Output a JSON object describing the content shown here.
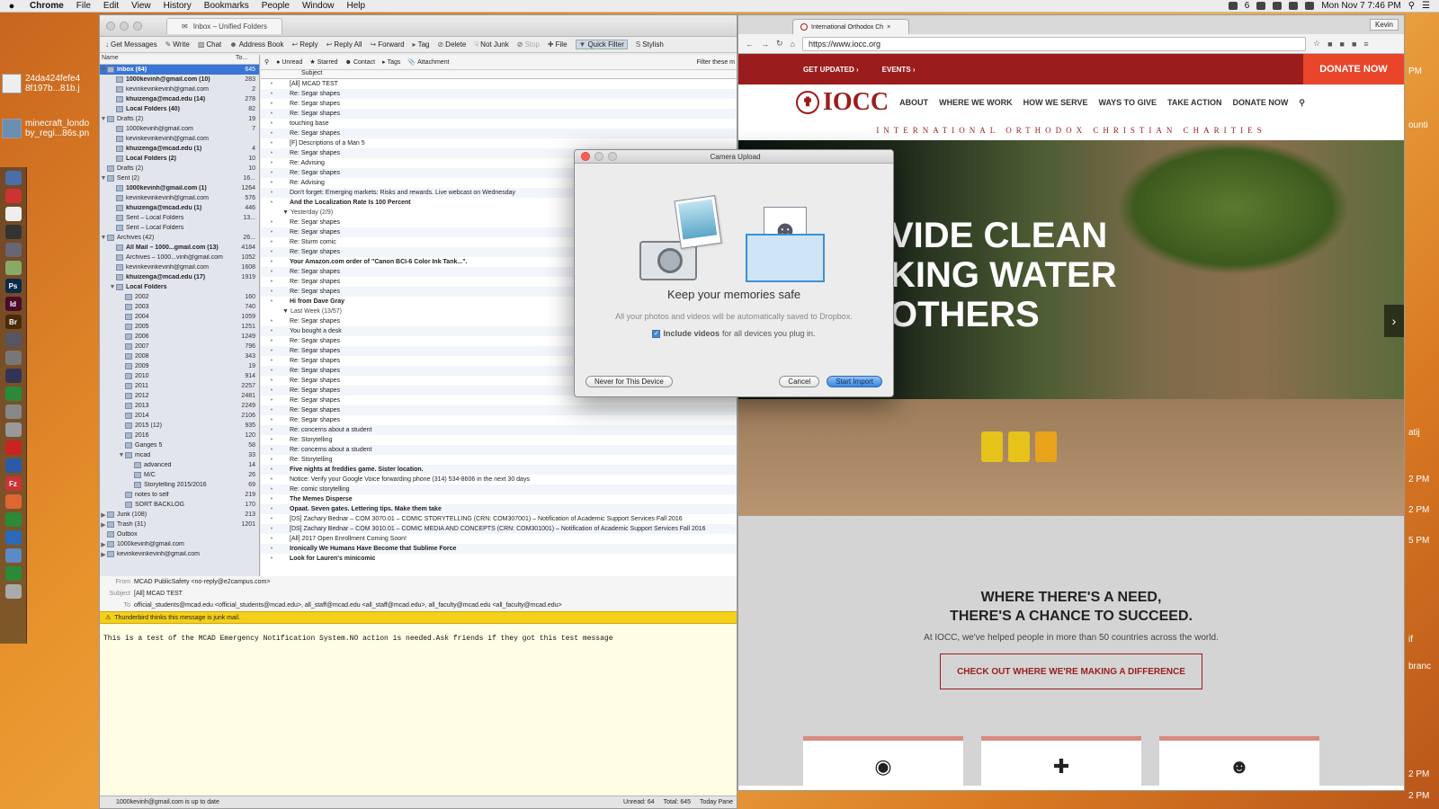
{
  "menubar": {
    "apple": "",
    "items": [
      "Chrome",
      "File",
      "Edit",
      "View",
      "History",
      "Bookmarks",
      "People",
      "Window",
      "Help"
    ],
    "status": {
      "battery": "6",
      "clock": "Mon Nov 7  7:46 PM"
    }
  },
  "desktop": {
    "file1_line1": "24da424fefe4",
    "file1_line2": "8f197b...81b.j",
    "file2_line1": "minecraft_londo",
    "file2_line2": "by_regi...86s.pn"
  },
  "dock": [
    "Ps",
    "Id",
    "Br",
    "Fz"
  ],
  "thunderbird": {
    "tab_title": "Inbox – Unified Folders",
    "toolbar": [
      "Get Messages",
      "Write",
      "Chat",
      "Address Book",
      "Reply",
      "Reply All",
      "Forward",
      "Tag",
      "Delete",
      "Not Junk",
      "Stop",
      "File",
      "Quick Filter",
      "Stylish"
    ],
    "filter_placeholder": "Filter these m",
    "quickfilter": [
      "Unread",
      "Starred",
      "Contact",
      "Tags",
      "Attachment"
    ],
    "folder_header": {
      "name": "Name",
      "total": "To..."
    },
    "folders": [
      {
        "name": "Inbox (64)",
        "count": "645",
        "sel": true,
        "bold": true,
        "lvl": 0,
        "tw": "▼"
      },
      {
        "name": "1000kevinh@gmail.com (10)",
        "count": "283",
        "bold": true,
        "lvl": 1
      },
      {
        "name": "kevinkevinkevinh@gmail.com",
        "count": "2",
        "lvl": 1
      },
      {
        "name": "khuizenga@mcad.edu (14)",
        "count": "278",
        "bold": true,
        "lvl": 1
      },
      {
        "name": "Local Folders (40)",
        "count": "82",
        "bold": true,
        "lvl": 1
      },
      {
        "name": "Drafts (2)",
        "count": "19",
        "lvl": 0,
        "tw": "▼"
      },
      {
        "name": "1000kevinh@gmail.com",
        "count": "7",
        "lvl": 1
      },
      {
        "name": "kevinkevinkevinh@gmail.com",
        "count": "",
        "lvl": 1
      },
      {
        "name": "khuizenga@mcad.edu (1)",
        "count": "4",
        "bold": true,
        "lvl": 1
      },
      {
        "name": "Local Folders (2)",
        "count": "10",
        "bold": true,
        "lvl": 1
      },
      {
        "name": "Drafts (2)",
        "count": "10",
        "lvl": 0
      },
      {
        "name": "Sent (2)",
        "count": "16...",
        "lvl": 0,
        "tw": "▼"
      },
      {
        "name": "1000kevinh@gmail.com (1)",
        "count": "1264",
        "bold": true,
        "lvl": 1
      },
      {
        "name": "kevinkevinkevinh@gmail.com",
        "count": "576",
        "lvl": 1
      },
      {
        "name": "khuizenga@mcad.edu (1)",
        "count": "446",
        "bold": true,
        "lvl": 1
      },
      {
        "name": "Sent – Local Folders",
        "count": "13...",
        "lvl": 1
      },
      {
        "name": "Sent – Local Folders",
        "count": "",
        "lvl": 1
      },
      {
        "name": "Archives (42)",
        "count": "26...",
        "lvl": 0,
        "tw": "▼"
      },
      {
        "name": "All Mail – 1000...gmail.com (13)",
        "count": "4184",
        "bold": true,
        "lvl": 1
      },
      {
        "name": "Archives – 1000...vinh@gmail.com",
        "count": "1052",
        "lvl": 1
      },
      {
        "name": "kevinkevinkevinh@gmail.com",
        "count": "1608",
        "lvl": 1
      },
      {
        "name": "khuizenga@mcad.edu (17)",
        "count": "1919",
        "bold": true,
        "lvl": 1
      },
      {
        "name": "Local Folders",
        "count": "",
        "bold": true,
        "lvl": 1,
        "tw": "▼"
      },
      {
        "name": "2002",
        "count": "160",
        "lvl": 2
      },
      {
        "name": "2003",
        "count": "740",
        "lvl": 2
      },
      {
        "name": "2004",
        "count": "1059",
        "lvl": 2
      },
      {
        "name": "2005",
        "count": "1251",
        "lvl": 2
      },
      {
        "name": "2006",
        "count": "1249",
        "lvl": 2
      },
      {
        "name": "2007",
        "count": "796",
        "lvl": 2
      },
      {
        "name": "2008",
        "count": "343",
        "lvl": 2
      },
      {
        "name": "2009",
        "count": "19",
        "lvl": 2
      },
      {
        "name": "2010",
        "count": "914",
        "lvl": 2
      },
      {
        "name": "2011",
        "count": "2257",
        "lvl": 2
      },
      {
        "name": "2012",
        "count": "2481",
        "lvl": 2
      },
      {
        "name": "2013",
        "count": "2249",
        "lvl": 2
      },
      {
        "name": "2014",
        "count": "2106",
        "lvl": 2
      },
      {
        "name": "2015 (12)",
        "count": "935",
        "lvl": 2
      },
      {
        "name": "2016",
        "count": "120",
        "lvl": 2
      },
      {
        "name": "Ganges 5",
        "count": "58",
        "lvl": 2
      },
      {
        "name": "mcad",
        "count": "33",
        "lvl": 2,
        "tw": "▼"
      },
      {
        "name": "advanced",
        "count": "14",
        "lvl": 3
      },
      {
        "name": "M/C",
        "count": "26",
        "lvl": 3
      },
      {
        "name": "Storytelling 2015/2016",
        "count": "69",
        "lvl": 3
      },
      {
        "name": "notes to self",
        "count": "219",
        "lvl": 2
      },
      {
        "name": "SORT BACKLOG",
        "count": "170",
        "lvl": 2
      },
      {
        "name": "Junk (108)",
        "count": "213",
        "lvl": 0,
        "tw": "▶"
      },
      {
        "name": "Trash (31)",
        "count": "1201",
        "lvl": 0,
        "tw": "▶"
      },
      {
        "name": "Outbox",
        "count": "",
        "lvl": 0
      },
      {
        "name": "1000kevinh@gmail.com",
        "count": "",
        "lvl": 0,
        "tw": "▶"
      },
      {
        "name": "kevinkevinkevinh@gmail.com",
        "count": "",
        "lvl": 0,
        "tw": "▶"
      }
    ],
    "subject_header": "Subject",
    "messages": [
      {
        "s": "[All] MCAD TEST"
      },
      {
        "s": "Re: Segar shapes"
      },
      {
        "s": "Re: Segar shapes"
      },
      {
        "s": "Re: Segar shapes"
      },
      {
        "s": "touching base"
      },
      {
        "s": "Re: Segar shapes"
      },
      {
        "s": "[F] Descriptions of a Man 5"
      },
      {
        "s": "Re: Segar shapes"
      },
      {
        "s": "Re: Advising"
      },
      {
        "s": "Re: Segar shapes"
      },
      {
        "s": "Re: Advising"
      },
      {
        "s": "Don't forget: Emerging markets: Risks and rewards. Live webcast on Wednesday"
      },
      {
        "s": "And the Localization Rate Is 100 Percent",
        "b": true
      },
      {
        "s": "Yesterday (2/9)",
        "g": true
      },
      {
        "s": "Re: Segar shapes"
      },
      {
        "s": "Re: Segar shapes"
      },
      {
        "s": "Re: Sturm comic"
      },
      {
        "s": "Re: Segar shapes"
      },
      {
        "s": "Your Amazon.com order of \"Canon BCI-6 Color Ink Tank...\".",
        "b": true
      },
      {
        "s": "Re: Segar shapes"
      },
      {
        "s": "Re: Segar shapes"
      },
      {
        "s": "Re: Segar shapes"
      },
      {
        "s": "Hi from Dave Gray",
        "b": true
      },
      {
        "s": "Last Week (13/57)",
        "g": true
      },
      {
        "s": "Re: Segar shapes"
      },
      {
        "s": "You bought a desk"
      },
      {
        "s": "Re: Segar shapes"
      },
      {
        "s": "Re: Segar shapes"
      },
      {
        "s": "Re: Segar shapes"
      },
      {
        "s": "Re: Segar shapes"
      },
      {
        "s": "Re: Segar shapes"
      },
      {
        "s": "Re: Segar shapes"
      },
      {
        "s": "Re: Segar shapes"
      },
      {
        "s": "Re: Segar shapes"
      },
      {
        "s": "Re: Segar shapes"
      },
      {
        "s": "Re: concerns about a student"
      },
      {
        "s": "Re: Storytelling"
      },
      {
        "s": "Re: concerns about a student"
      },
      {
        "s": "Re: Storytelling"
      },
      {
        "s": "Five nights at freddies game. Sister location.",
        "b": true
      },
      {
        "s": "Notice: Verify your Google Voice forwarding phone (314) 534-8606 in the next 30 days"
      },
      {
        "s": "Re: comic storytelling"
      },
      {
        "s": "The Memes Disperse",
        "b": true
      },
      {
        "s": "Opaat. Seven gates. Lettering tips. Make them take",
        "b": true
      },
      {
        "s": "[DS] Zachary Bednar – COM 3070.01 – COMIC STORYTELLING (CRN: COM307001) – Notification of Academic Support Services Fall 2016"
      },
      {
        "s": "[DS] Zachary Bednar – COM 3010.01 – COMIC MEDIA AND CONCEPTS (CRN: COM301001) – Notification of Academic Support Services Fall 2016"
      },
      {
        "s": "[All] 2017 Open Enrollment Coming Soon!"
      },
      {
        "s": "Ironically We Humans Have Become that Sublime Force",
        "b": true
      },
      {
        "s": "Look for Lauren's minicomic",
        "b": true
      }
    ],
    "preview": {
      "from_label": "From",
      "from": "MCAD PublicSafety <no-reply@e2campus.com>",
      "subject_label": "Subject",
      "subject": "[All] MCAD TEST",
      "to_label": "To",
      "to": "official_students@mcad.edu <official_students@mcad.edu>, all_staff@mcad.edu <all_staff@mcad.edu>, all_faculty@mcad.edu <all_faculty@mcad.edu>",
      "junk": "Thunderbird thinks this message is junk mail.",
      "body": "This is a test of the MCAD Emergency Notification System.NO action is needed.Ask friends if they got this test message"
    },
    "status": {
      "left": "1000kevinh@gmail.com is up to date",
      "unread": "Unread: 64",
      "total": "Total: 645",
      "today": "Today Pane"
    }
  },
  "chrome": {
    "tab_title": "International Orthodox Ch",
    "profile": "Kevin",
    "url": "https://www.iocc.org",
    "site": {
      "top_links": [
        "GET UPDATED ›",
        "EVENTS ›"
      ],
      "donate_now": "DONATE NOW",
      "logo": "IOCC",
      "nav": [
        "ABOUT",
        "WHERE WE WORK",
        "HOW WE SERVE",
        "WAYS TO GIVE",
        "TAKE ACTION",
        "DONATE NOW"
      ],
      "tagline": "INTERNATIONAL ORTHODOX CHRISTIAN CHARITIES",
      "hero_line1": "VIDE CLEAN",
      "hero_line2": "KING WATER",
      "hero_line3": "OTHERS",
      "need_line1": "WHERE THERE'S A NEED,",
      "need_line2": "THERE'S A CHANCE TO SUCCEED.",
      "need_text": "At IOCC, we've helped people in more than 50 countries across the world.",
      "cta": "CHECK OUT WHERE WE'RE MAKING A DIFFERENCE"
    }
  },
  "dialog": {
    "title": "Camera Upload",
    "heading": "Keep your memories safe",
    "text": "All your photos and videos will be automatically saved to Dropbox.",
    "checkbox_bold": "Include videos",
    "checkbox_rest": "for all devices you plug in.",
    "btn_never": "Never for This Device",
    "btn_cancel": "Cancel",
    "btn_start": "Start Import"
  },
  "right_strip": [
    "PM",
    "ounti",
    "2 PM",
    "2 PM",
    "5 PM",
    "atij",
    "2 PM",
    "2 PM",
    "branc",
    "if"
  ]
}
